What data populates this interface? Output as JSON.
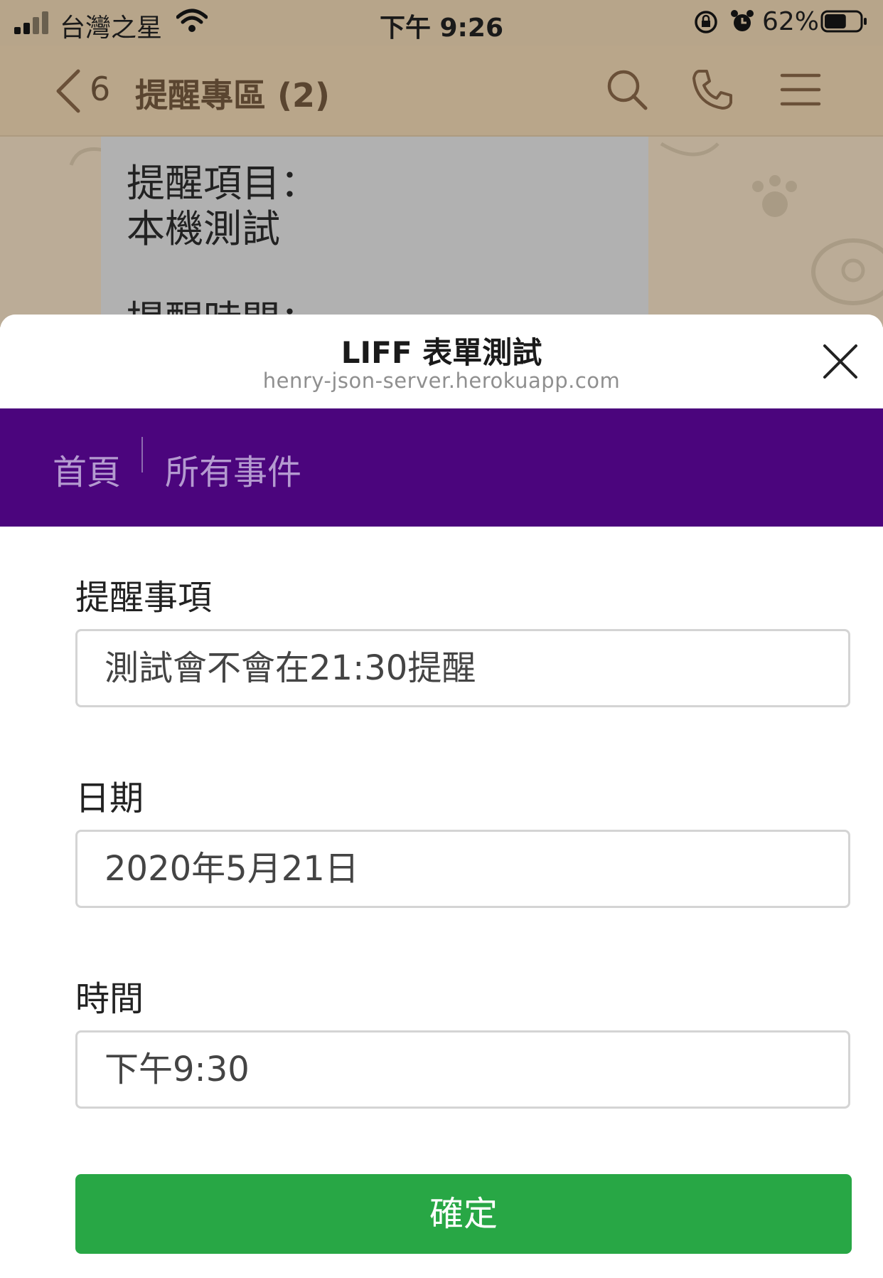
{
  "status_bar": {
    "carrier": "台灣之星",
    "time": "下午 9:26",
    "battery_percent": "62%",
    "battery_level": 0.62,
    "icons": [
      "signal-icon",
      "wifi-icon",
      "orientation-lock-icon",
      "alarm-icon",
      "battery-icon"
    ]
  },
  "chat_header": {
    "unread_count": "6",
    "title": "提醒專區 (2)",
    "icons": [
      "back-chevron-icon",
      "search-icon",
      "phone-icon",
      "menu-icon"
    ]
  },
  "chat_message": {
    "line1": "提醒項目：",
    "line2": "本機測試",
    "line3": "提醒時間："
  },
  "liff": {
    "title": "LIFF 表單測試",
    "url": "henry-json-server.herokuapp.com",
    "close_icon": "close-icon"
  },
  "nav": {
    "items": [
      {
        "label": "首頁"
      },
      {
        "label": "所有事件"
      }
    ]
  },
  "form": {
    "reminder": {
      "label": "提醒事項",
      "value": "測試會不會在21:30提醒"
    },
    "date": {
      "label": "日期",
      "value": "2020年5月21日"
    },
    "time": {
      "label": "時間",
      "value": "下午9:30"
    },
    "submit_label": "確定"
  },
  "colors": {
    "purple_nav": "#4b057d",
    "submit_green": "#28a745",
    "chat_header_bg": "#b9a68a"
  }
}
